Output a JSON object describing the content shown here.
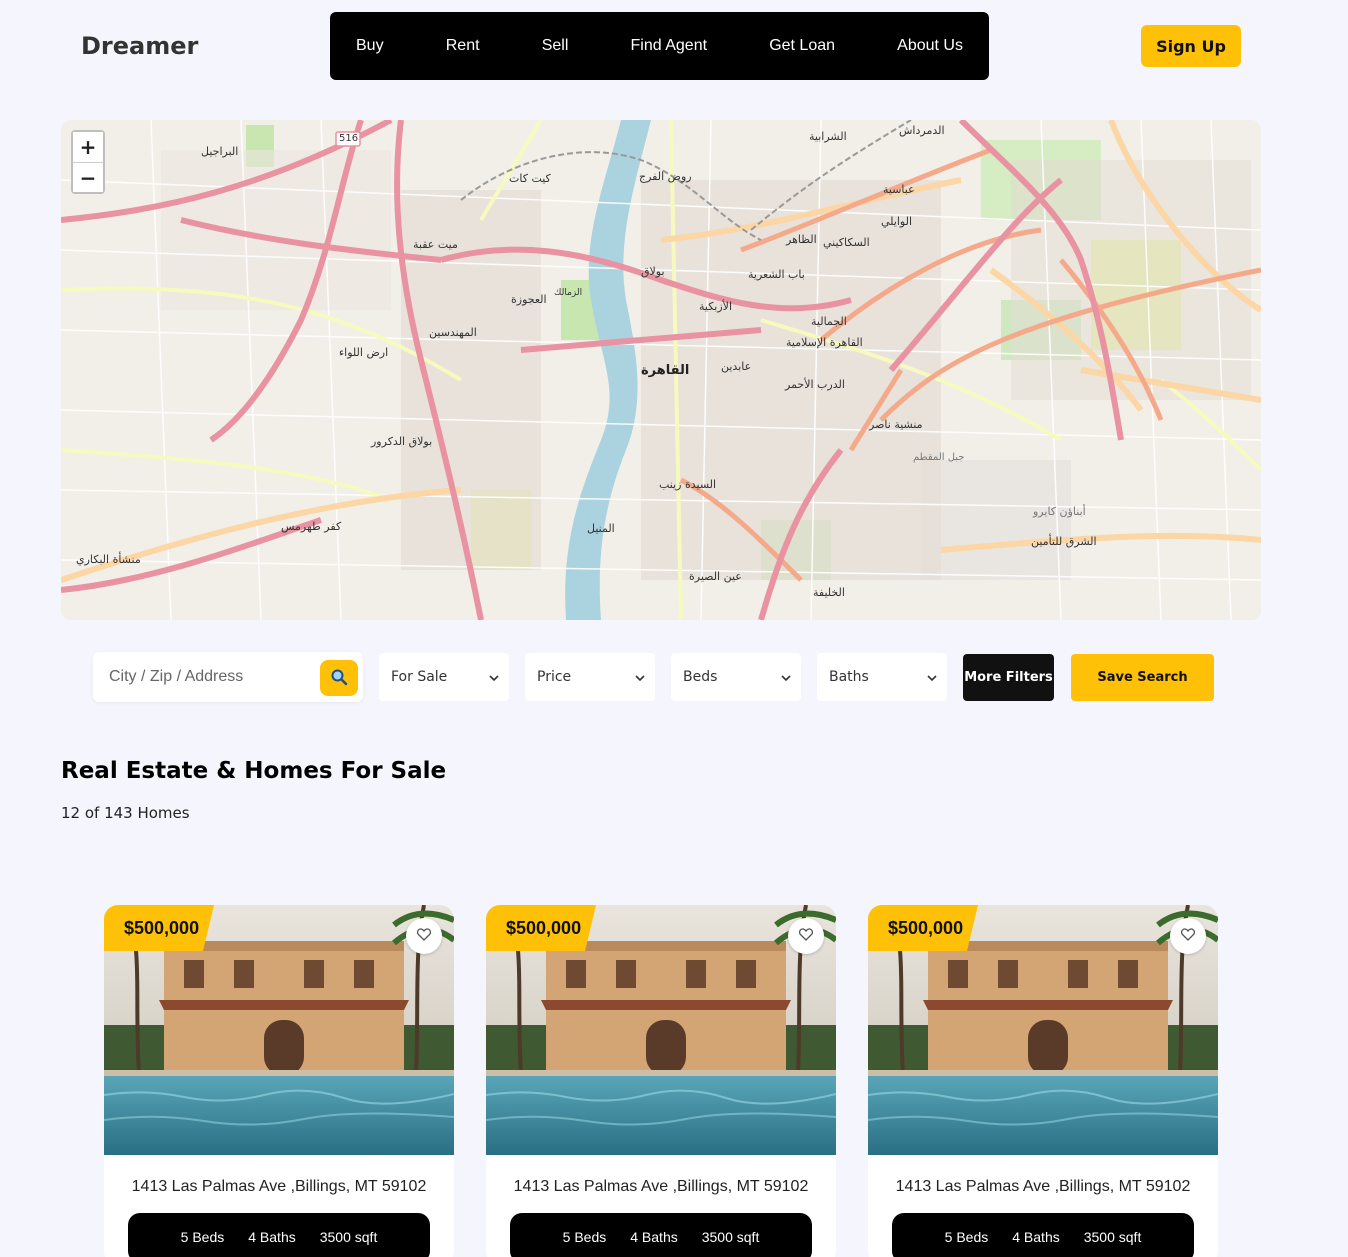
{
  "brand": "Dreamer",
  "nav": [
    "Buy",
    "Rent",
    "Sell",
    "Find Agent",
    "Get Loan",
    "About Us"
  ],
  "signup_label": "Sign Up",
  "map": {
    "zoom_in": "+",
    "zoom_out": "−",
    "labels": [
      "البراجيل",
      "كيت كات",
      "روض الفرج",
      "الشرابية",
      "الدمرداش",
      "ميت عقبة",
      "الزمالك",
      "بولاق",
      "الظاهر",
      "السكاكيني",
      "الوايلي",
      "عباسية",
      "العجوزة",
      "المهندسين",
      "الأزبكية",
      "باب الشعرية",
      "الجمالية",
      "القاهرة",
      "عابدين",
      "الدرب الأحمر",
      "القاهرة الإسلامية",
      "منشية ناصر",
      "بولاق الدكرور",
      "السيدة زينب",
      "المنيل",
      "عين الصيرة",
      "كفر طهرمس",
      "منشأة البكاري",
      "ارض اللواء",
      "جبل المقطم",
      "الشرق للتأمين",
      "أبناؤن كايرو",
      "الخليفة"
    ],
    "shield": "516"
  },
  "search": {
    "placeholder": "City / Zip / Address",
    "status": "For Sale",
    "price": "Price",
    "beds": "Beds",
    "baths": "Baths",
    "more_filters": "More Filters",
    "save_search": "Save Search"
  },
  "listing": {
    "title": "Real Estate & Homes For Sale",
    "count": "12 of 143 Homes"
  },
  "cards": [
    {
      "price": "$500,000",
      "address": "1413 Las Palmas Ave ,Billings, MT 59102",
      "beds": "5 Beds",
      "baths": "4 Baths",
      "sqft": "3500 sqft"
    },
    {
      "price": "$500,000",
      "address": "1413 Las Palmas Ave ,Billings, MT 59102",
      "beds": "5 Beds",
      "baths": "4 Baths",
      "sqft": "3500 sqft"
    },
    {
      "price": "$500,000",
      "address": "1413 Las Palmas Ave ,Billings, MT 59102",
      "beds": "5 Beds",
      "baths": "4 Baths",
      "sqft": "3500 sqft"
    }
  ],
  "colors": {
    "accent": "#ffc107",
    "nav_bg": "#000000",
    "page_bg": "#f5f5fd"
  }
}
